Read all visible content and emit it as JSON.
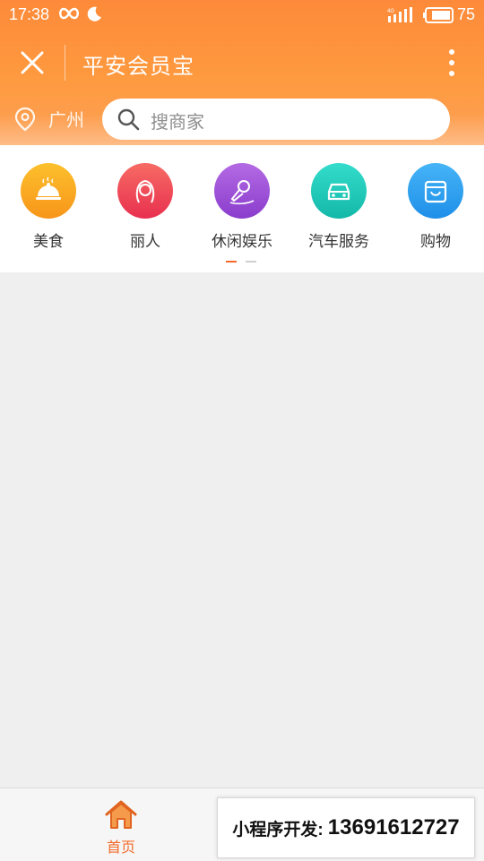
{
  "status_bar": {
    "time": "17:38",
    "battery_percent": "75",
    "network": "4G"
  },
  "header": {
    "title": "平安会员宝"
  },
  "location": {
    "city": "广州"
  },
  "search": {
    "placeholder": "搜商家"
  },
  "categories": [
    {
      "label": "美食",
      "icon": "food-cloche-icon",
      "color": "#f9a51b"
    },
    {
      "label": "丽人",
      "icon": "beauty-woman-icon",
      "color": "#f0445a"
    },
    {
      "label": "休闲娱乐",
      "icon": "karaoke-mic-icon",
      "color": "#9b4fd6"
    },
    {
      "label": "汽车服务",
      "icon": "car-icon",
      "color": "#1fc9b9"
    },
    {
      "label": "购物",
      "icon": "shopping-bag-icon",
      "color": "#2b9ef1"
    }
  ],
  "pager": {
    "pages": 2,
    "active_index": 0
  },
  "tabbar": {
    "home_label": "首页"
  },
  "promo": {
    "prefix": "小程序开发:",
    "phone": "13691612727"
  },
  "colors": {
    "header_orange": "#fd8a3a",
    "accent": "#f26b2b",
    "page_bg": "#efefef"
  }
}
